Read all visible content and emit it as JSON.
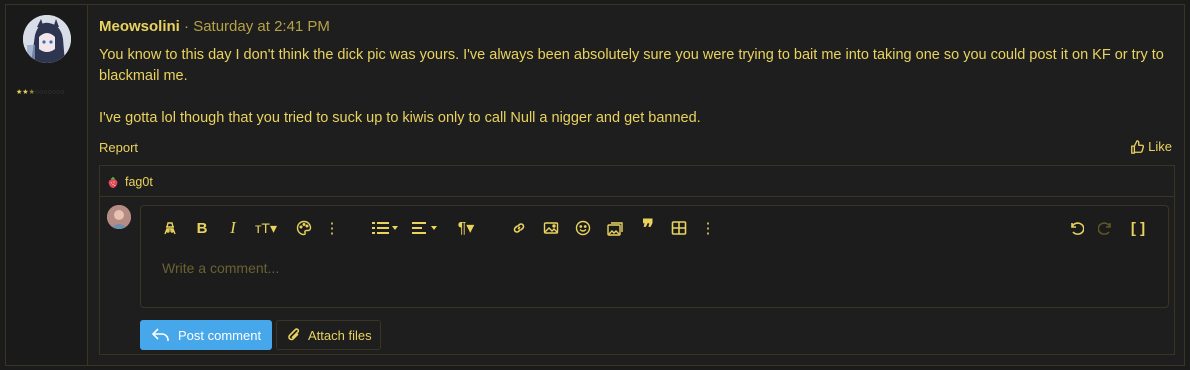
{
  "post": {
    "username": "Meowsolini",
    "separator": "·",
    "timestamp": "Saturday at 2:41 PM",
    "user_rating": {
      "filled_fraction": 0.25
    },
    "body": [
      "You know to this day I don't think the dick pic was yours. I've always been absolutely sure you were trying to bait me into taking one so you could post it on KF or try to blackmail me.",
      "I've gotta lol though that you tried to suck up to kiwis only to call Null a nigger and get banned."
    ],
    "actions": {
      "report": "Report",
      "like": "Like"
    },
    "reactions": {
      "user": "fag0t",
      "icon": "strawberry-icon"
    }
  },
  "comment": {
    "placeholder": "Write a comment...",
    "toolbar": [
      "spoiler-icon",
      "bold-icon",
      "italic-icon",
      "text-size-icon",
      "palette-icon",
      "more-icon",
      "list-icon",
      "align-icon",
      "paragraph-icon",
      "link-icon",
      "image-icon",
      "smilie-icon",
      "media-icon",
      "quote-icon",
      "table-icon",
      "more-icon",
      "undo-icon",
      "redo-icon",
      "bbcode-icon"
    ],
    "post_button": "Post comment",
    "attach_button": "Attach files"
  },
  "colors": {
    "accent": "#e9d35e",
    "button": "#47a7eb",
    "background": "#1e1e1e",
    "border": "#3a3520"
  }
}
